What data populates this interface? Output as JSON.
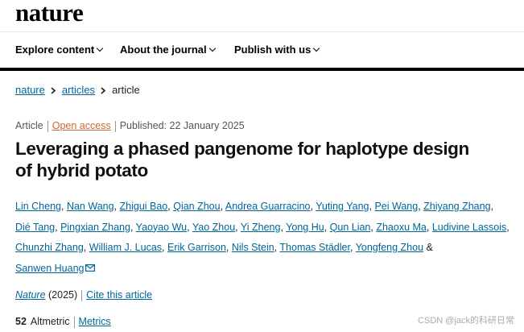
{
  "site": {
    "logo": "nature"
  },
  "nav": [
    {
      "label": "Explore content"
    },
    {
      "label": "About the journal"
    },
    {
      "label": "Publish with us"
    }
  ],
  "breadcrumb": {
    "items": [
      "nature",
      "articles"
    ],
    "current": "article"
  },
  "meta": {
    "type": "Article",
    "access": "Open access",
    "published": "Published: 22 January 2025"
  },
  "article": {
    "title_line1": "Leveraging a phased pangenome for haplotype design",
    "title_line2": "of hybrid potato"
  },
  "authors": [
    "Lin Cheng",
    "Nan Wang",
    "Zhigui Bao",
    "Qian Zhou",
    "Andrea Guarracino",
    "Yuting Yang",
    "Pei Wang",
    "Zhiyang Zhang",
    "Dié Tang",
    "Pingxian Zhang",
    "Yaoyao Wu",
    "Yao Zhou",
    "Yi Zheng",
    "Yong Hu",
    "Qun Lian",
    "Zhaoxu Ma",
    "Ludivine Lassois",
    "Chunzhi Zhang",
    "William J. Lucas",
    "Erik Garrison",
    "Nils Stein",
    "Thomas Städler",
    "Yongfeng Zhou",
    "Sanwen Huang"
  ],
  "author_amp": "&",
  "citation": {
    "journal": "Nature",
    "year": "(2025)",
    "cite_link": "Cite this article"
  },
  "metrics": {
    "altmetric_value": "52",
    "altmetric_label": "Altmetric",
    "metrics_link": "Metrics"
  },
  "watermark": "CSDN @jack的科研日常"
}
